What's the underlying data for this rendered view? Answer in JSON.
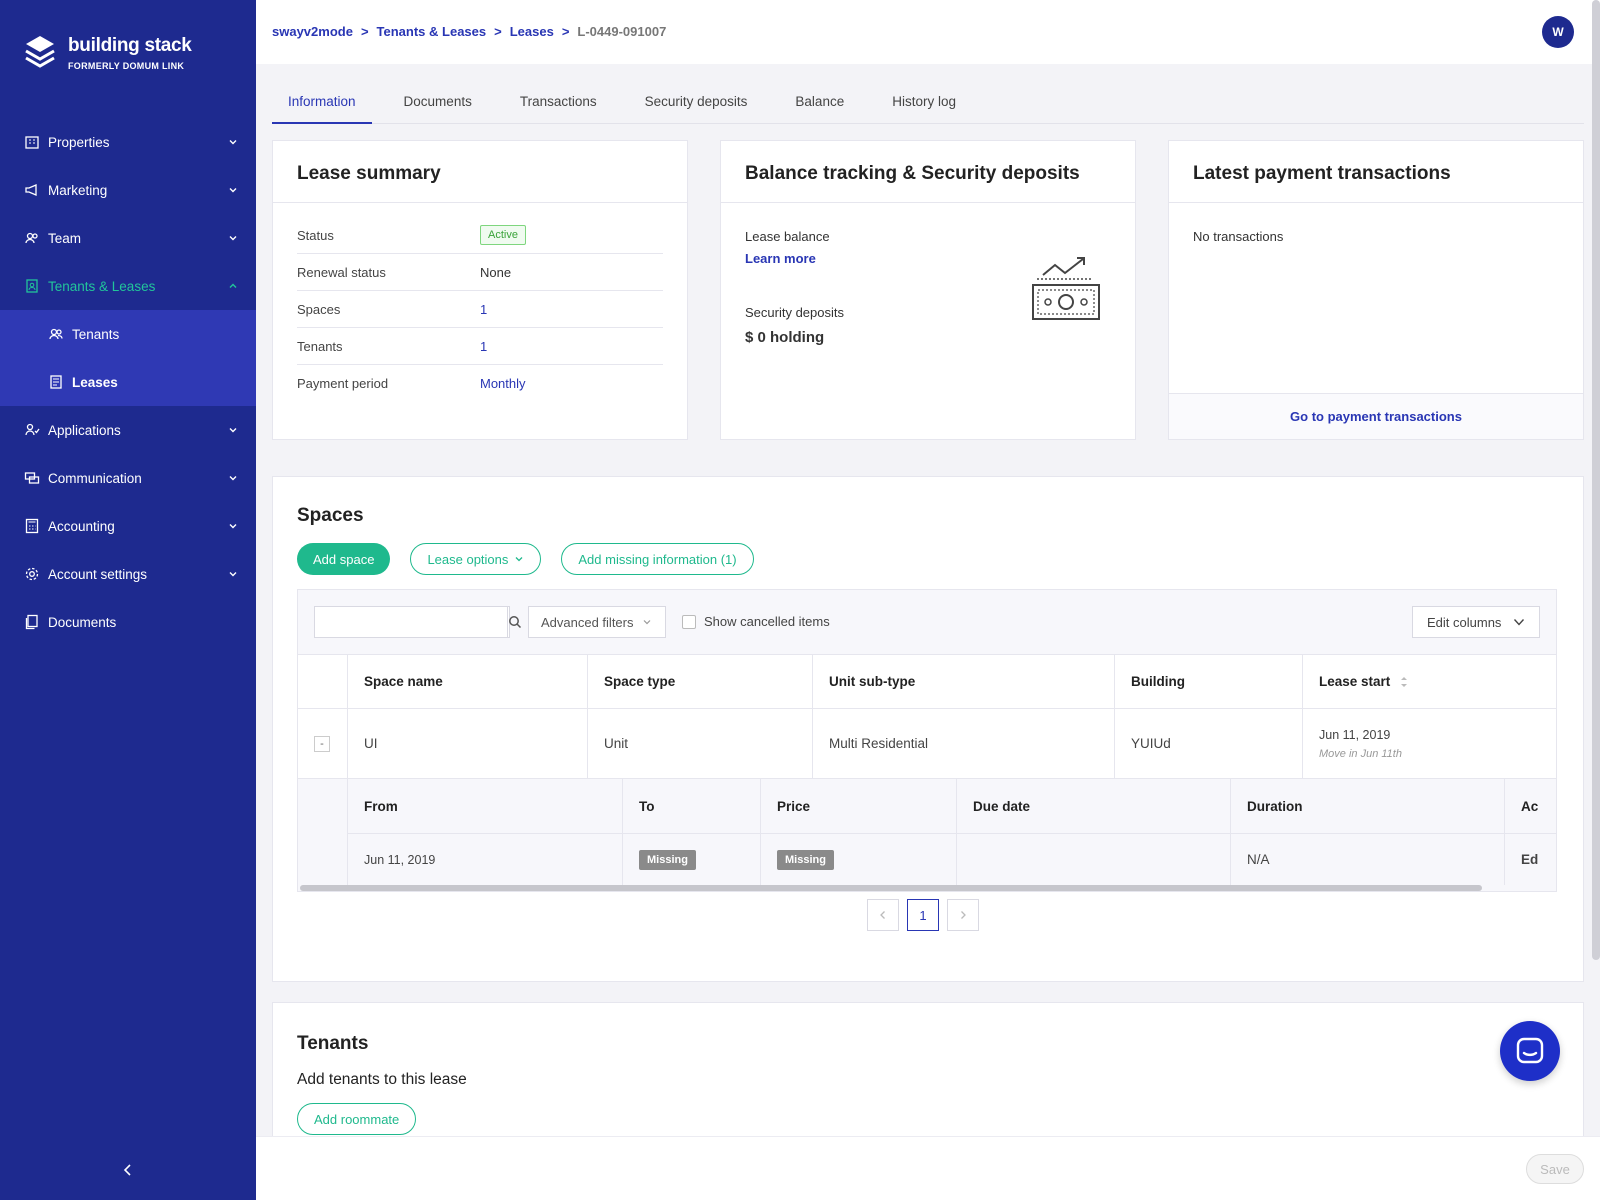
{
  "brand": {
    "name": "building stack",
    "subtitle": "FORMERLY DOMUM LINK"
  },
  "sidebar": {
    "items": [
      {
        "label": "Properties",
        "icon": "building-icon"
      },
      {
        "label": "Marketing",
        "icon": "megaphone-icon"
      },
      {
        "label": "Team",
        "icon": "team-icon"
      },
      {
        "label": "Tenants & Leases",
        "icon": "lease-icon",
        "active": true
      },
      {
        "label": "Applications",
        "icon": "applications-icon"
      },
      {
        "label": "Communication",
        "icon": "chat-icon"
      },
      {
        "label": "Accounting",
        "icon": "calculator-icon"
      },
      {
        "label": "Account settings",
        "icon": "gear-icon"
      },
      {
        "label": "Documents",
        "icon": "documents-icon"
      }
    ],
    "subitems": [
      {
        "label": "Tenants",
        "icon": "tenants-icon"
      },
      {
        "label": "Leases",
        "icon": "document-icon",
        "current": true
      }
    ]
  },
  "breadcrumb": {
    "root": "swayv2mode",
    "section": "Tenants & Leases",
    "list": "Leases",
    "current": "L-0449-091007",
    "separator": ">"
  },
  "user": {
    "avatar_initial": "W"
  },
  "tabs": [
    "Information",
    "Documents",
    "Transactions",
    "Security deposits",
    "Balance",
    "History log"
  ],
  "lease_summary": {
    "title": "Lease summary",
    "rows": [
      {
        "label": "Status",
        "value": "Active"
      },
      {
        "label": "Renewal status",
        "value": "None"
      },
      {
        "label": "Spaces",
        "value": "1"
      },
      {
        "label": "Tenants",
        "value": "1"
      },
      {
        "label": "Payment period",
        "value": "Monthly"
      }
    ]
  },
  "balance": {
    "title": "Balance tracking & Security deposits",
    "lease_balance_label": "Lease balance",
    "learn_more": "Learn more",
    "deposits_label": "Security deposits",
    "deposits_value": "$ 0 holding"
  },
  "payments": {
    "title": "Latest payment transactions",
    "empty": "No transactions",
    "link": "Go to payment transactions"
  },
  "spaces": {
    "title": "Spaces",
    "add_space": "Add space",
    "lease_options": "Lease options",
    "add_missing": "Add missing information (1)",
    "search_placeholder": "",
    "advanced_filters": "Advanced filters",
    "show_cancelled": "Show cancelled items",
    "edit_columns": "Edit columns",
    "columns": [
      "Space name",
      "Space type",
      "Unit sub-type",
      "Building",
      "Lease start"
    ],
    "row": {
      "expand": "-",
      "space_name": "UI",
      "space_type": "Unit",
      "unit_subtype": "Multi Residential",
      "building": "YUIUd",
      "lease_start": "Jun 11, 2019",
      "move_in": "Move in Jun 11th"
    },
    "sub_columns": [
      "From",
      "To",
      "Price",
      "Due date",
      "Duration",
      "Ac"
    ],
    "sub_row": {
      "from": "Jun 11, 2019",
      "to": "Missing",
      "price": "Missing",
      "due_date": "",
      "duration": "N/A",
      "action": "Ed"
    },
    "page": "1"
  },
  "tenants": {
    "title": "Tenants",
    "subtitle": "Add tenants to this lease",
    "add_roommate": "Add roommate"
  },
  "footer": {
    "save": "Save"
  },
  "colors": {
    "sidebar": "#1e2a8f",
    "accent": "#1fb98d",
    "link": "#2936b4"
  }
}
